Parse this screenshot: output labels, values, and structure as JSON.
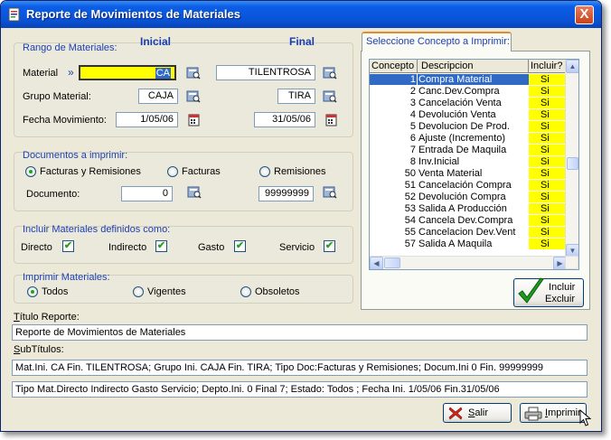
{
  "window": {
    "title": "Reporte de Movimientos de Materiales",
    "close_glyph": "X"
  },
  "rango": {
    "legend": "Rango de Materiales:",
    "header_inicial": "Inicial",
    "header_final": "Final",
    "arrow": "»",
    "material_label": "Material",
    "material_ini": "CA",
    "material_fin": "TILENTROSA",
    "grupo_label": "Grupo Material:",
    "grupo_ini": "CAJA",
    "grupo_fin": "TIRA",
    "fecha_label": "Fecha Movimiento:",
    "fecha_ini": "1/05/06",
    "fecha_fin": "31/05/06"
  },
  "documentos": {
    "legend": "Documentos a imprimir:",
    "opt_fact_rem": "Facturas y Remisiones",
    "opt_fact": "Facturas",
    "opt_rem": "Remisiones",
    "documento_label": "Documento:",
    "doc_ini": "0",
    "doc_fin": "99999999"
  },
  "incluir": {
    "legend": "Incluir Materiales definidos como:",
    "directo": "Directo",
    "indirecto": "Indirecto",
    "gasto": "Gasto",
    "servicio": "Servicio",
    "check_glyph": "✔"
  },
  "imprimir_mat": {
    "legend": "Imprimir Materiales:",
    "todos": "Todos",
    "vigentes": "Vigentes",
    "obsoletos": "Obsoletos"
  },
  "concepto": {
    "tab_label": "Seleccione Concepto a Imprimir:",
    "col_concepto": "Concepto",
    "col_descripcion": "Descripcion",
    "col_incluir": "Incluir?",
    "rows": [
      {
        "num": "1",
        "desc": "Compra Material",
        "inc": "Si"
      },
      {
        "num": "2",
        "desc": "Canc.Dev.Compra",
        "inc": "Si"
      },
      {
        "num": "3",
        "desc": "Cancelación Venta",
        "inc": "Si"
      },
      {
        "num": "4",
        "desc": "Devolución Venta",
        "inc": "Si"
      },
      {
        "num": "5",
        "desc": "Devolucion De Prod.",
        "inc": "Si"
      },
      {
        "num": "6",
        "desc": "Ajuste (Incremento)",
        "inc": "Si"
      },
      {
        "num": "7",
        "desc": "Entrada De Maquila",
        "inc": "Si"
      },
      {
        "num": "8",
        "desc": "Inv.Inicial",
        "inc": "Si"
      },
      {
        "num": "50",
        "desc": "Venta Material",
        "inc": "Si"
      },
      {
        "num": "51",
        "desc": "Cancelación Compra",
        "inc": "Si"
      },
      {
        "num": "52",
        "desc": "Devolución Compra",
        "inc": "Si"
      },
      {
        "num": "53",
        "desc": "Salida A Producción",
        "inc": "Si"
      },
      {
        "num": "54",
        "desc": "Cancela Dev.Compra",
        "inc": "Si"
      },
      {
        "num": "55",
        "desc": "Cancelacion Dev.Vent",
        "inc": "Si"
      },
      {
        "num": "57",
        "desc": "Salida A Maquila",
        "inc": "Si"
      }
    ],
    "incluir_btn_line1": "Incluir",
    "incluir_btn_line2": "Excluir"
  },
  "titulo": {
    "label_first": "T",
    "label_rest": "ítulo Reporte:",
    "value": "Reporte de Movimientos de Materiales"
  },
  "subtitulos": {
    "label_first": "S",
    "label_rest": "ubTítulos:",
    "line1": "Mat.Ini. CA Fin. TILENTROSA;   Grupo Ini. CAJA Fin. TIRA;  Tipo Doc:Facturas y Remisiones; Docum.Ini 0 Fin. 99999999",
    "line2": "Tipo Mat.Directo Indirecto Gasto Servicio;  Depto.Ini. 0 Final 7;  Estado: Todos    ; Fecha Ini. 1/05/06 Fin.31/05/06"
  },
  "buttons": {
    "salir_first": "S",
    "salir_rest": "alir",
    "imprimir_first": "I",
    "imprimir_rest": "mprimir"
  }
}
